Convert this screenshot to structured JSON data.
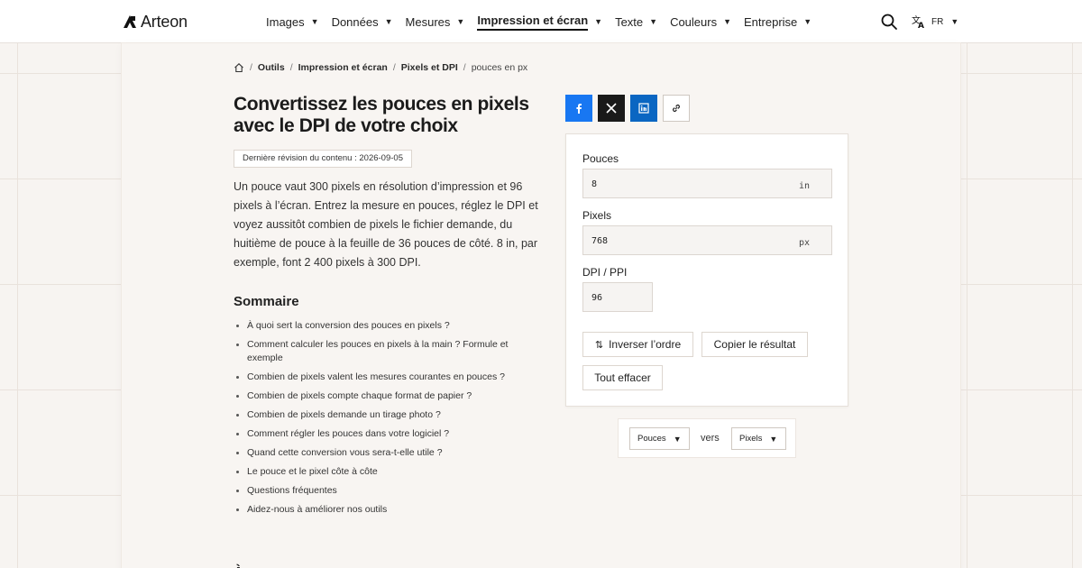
{
  "header": {
    "logo_text": "Arteon",
    "nav": [
      {
        "label": "Images"
      },
      {
        "label": "Données"
      },
      {
        "label": "Mesures"
      },
      {
        "label": "Impression et écran",
        "active": true
      },
      {
        "label": "Texte"
      },
      {
        "label": "Couleurs"
      },
      {
        "label": "Entreprise"
      }
    ],
    "lang": "FR",
    "icons": {
      "search": "search-icon",
      "translate": "translate-icon",
      "home": "home-icon"
    }
  },
  "breadcrumb": {
    "items": [
      "Outils",
      "Impression et écran",
      "Pixels et DPI"
    ],
    "current": "pouces en px"
  },
  "article": {
    "title": "Convertissez les pouces en pixels avec le DPI de votre choix",
    "revision": "Dernière révision du contenu : 2026-09-05",
    "intro": "Un pouce vaut 300 pixels en résolution d’impression et 96 pixels à l’écran. Entrez la mesure en pouces, réglez le DPI et voyez aussitôt combien de pixels le fichier demande, du huitième de pouce à la feuille de 36 pouces de côté. 8 in, par exemple, font 2 400 pixels à 300 DPI.",
    "toc_title": "Sommaire",
    "toc": [
      "À quoi sert la conversion des pouces en pixels ?",
      "Comment calculer les pouces en pixels à la main ? Formule et exemple",
      "Combien de pixels valent les mesures courantes en pouces ?",
      "Combien de pixels compte chaque format de papier ?",
      "Combien de pixels demande un tirage photo ?",
      "Comment régler les pouces dans votre logiciel ?",
      "Quand cette conversion vous sera-t-elle utile ?",
      "Le pouce et le pixel côte à côte",
      "Questions fréquentes",
      "Aidez-nous à améliorer nos outils"
    ],
    "next_heading_partial": "À"
  },
  "share": {
    "icons": [
      "facebook-icon",
      "x-icon",
      "linkedin-icon",
      "link-icon"
    ],
    "colors": {
      "facebook": "#1877f2",
      "x": "#1a1a1a",
      "linkedin": "#0a66c2"
    }
  },
  "converter": {
    "inches": {
      "label": "Pouces",
      "value": "8",
      "unit": "in"
    },
    "pixels": {
      "label": "Pixels",
      "value": "768",
      "unit": "px"
    },
    "dpi": {
      "label": "DPI / PPI",
      "value": "96"
    },
    "swap_label": "Inverser l’ordre",
    "copy_label": "Copier le résultat",
    "clear_label": "Tout effacer"
  },
  "units": {
    "from": "Pouces",
    "to": "Pixels",
    "between": "vers"
  }
}
